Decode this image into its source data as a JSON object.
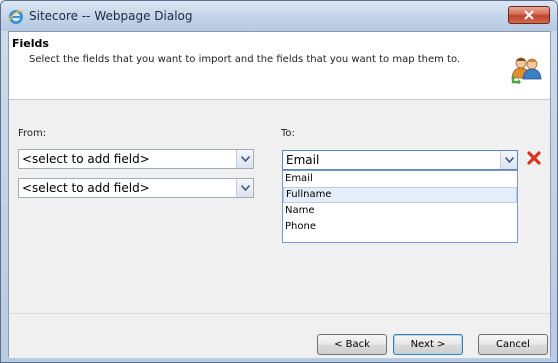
{
  "window": {
    "title": "Sitecore -- Webpage Dialog"
  },
  "header": {
    "title": "Fields",
    "description": "Select the fields that you want to import and the fields that you want to map them to."
  },
  "mapping": {
    "from_label": "From:",
    "to_label": "To:",
    "from_rows": [
      {
        "value": "<select to add field>"
      },
      {
        "value": "<select to add field>"
      }
    ],
    "to_rows": [
      {
        "value": "Email"
      }
    ],
    "to_options": [
      "Email",
      "Fullname",
      "Name",
      "Phone"
    ],
    "hovered_option": "Fullname"
  },
  "footer": {
    "back_label": "< Back",
    "next_label": "Next >",
    "cancel_label": "Cancel"
  },
  "colors": {
    "remove_red": "#d9321f",
    "users_green": "#4aa53a"
  }
}
